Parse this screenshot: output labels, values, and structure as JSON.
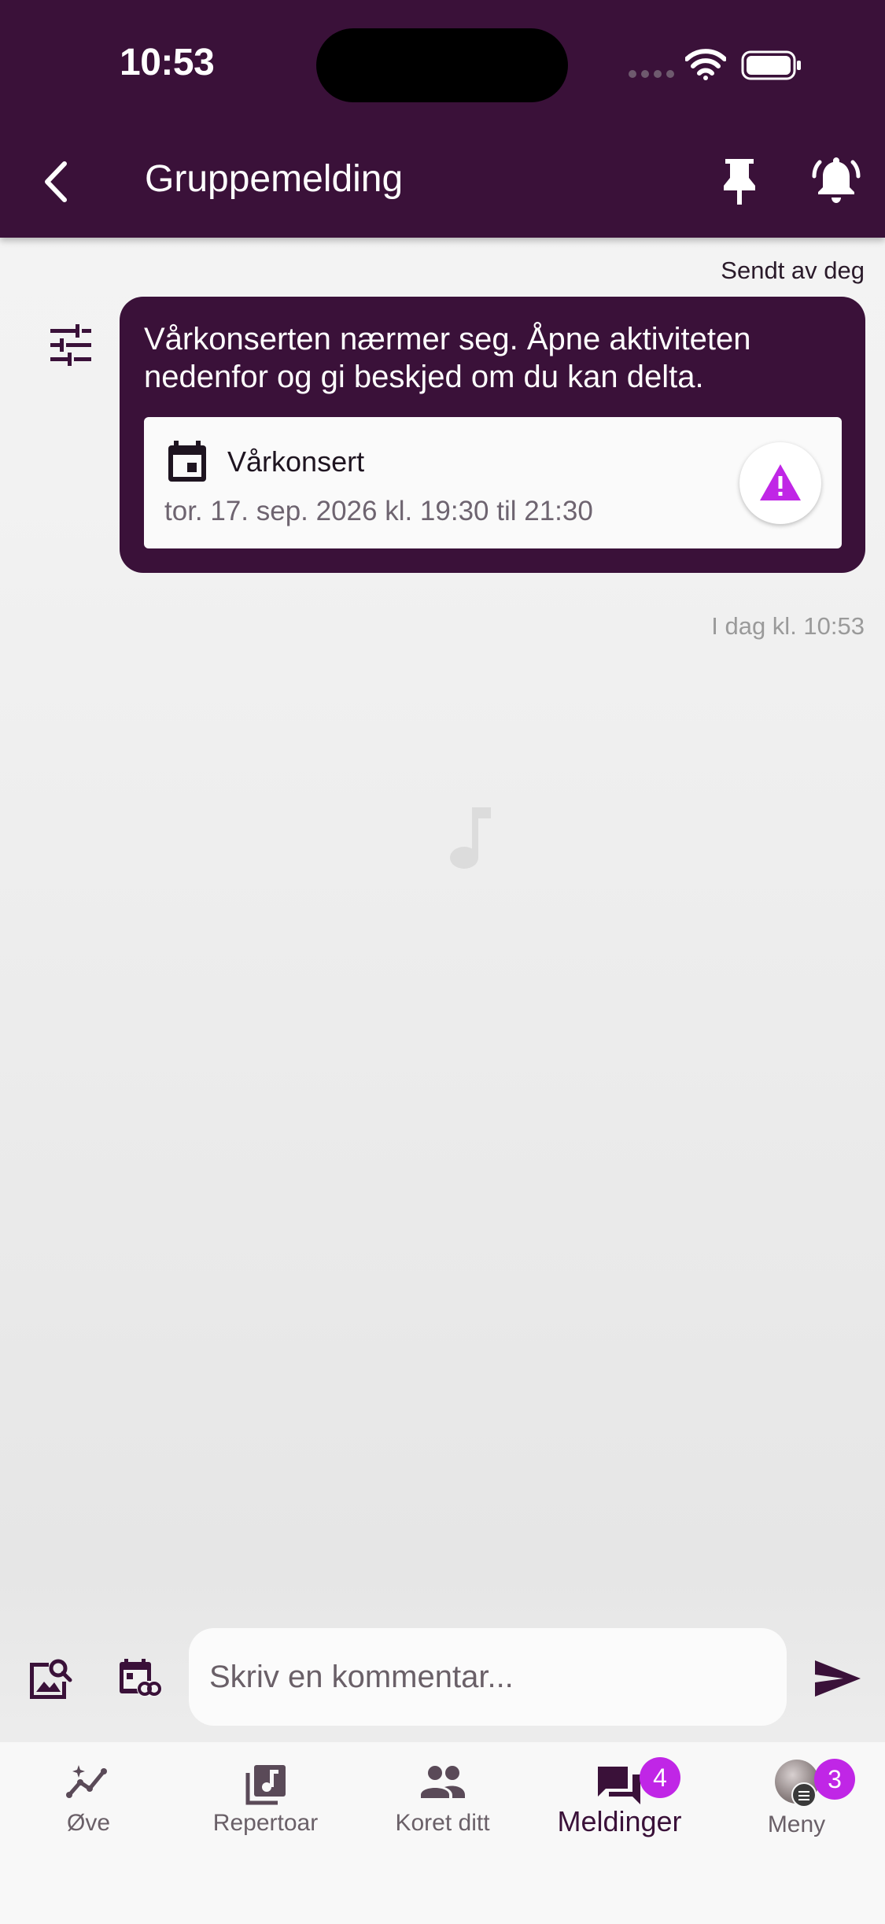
{
  "status_bar": {
    "time": "10:53"
  },
  "header": {
    "title": "Gruppemelding"
  },
  "message": {
    "sender": "Sendt av deg",
    "text": "Vårkonserten nærmer seg. Åpne aktiviteten nedenfor og gi beskjed om du kan delta.",
    "event": {
      "title": "Vårkonsert",
      "date": "tor. 17. sep. 2026 kl. 19:30 til 21:30",
      "icon": "calendar-icon",
      "warning_icon": "warning-icon"
    },
    "timestamp": "I dag kl. 10:53"
  },
  "composer": {
    "placeholder": "Skriv en kommentar..."
  },
  "tabs": [
    {
      "label": "Øve",
      "icon": "practice-icon"
    },
    {
      "label": "Repertoar",
      "icon": "repertoire-icon"
    },
    {
      "label": "Koret ditt",
      "icon": "group-icon"
    },
    {
      "label": "Meldinger",
      "icon": "messages-icon",
      "badge": "4",
      "active": true
    },
    {
      "label": "Meny",
      "icon": "avatar",
      "badge": "3"
    }
  ],
  "colors": {
    "primary": "#3a1139",
    "accent": "#c026e6"
  }
}
